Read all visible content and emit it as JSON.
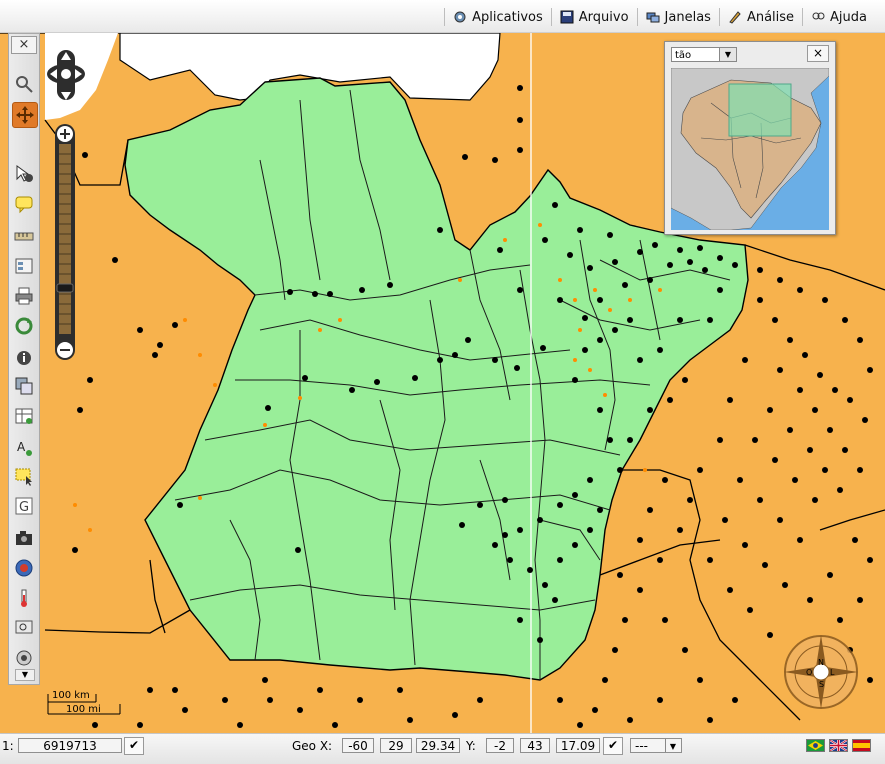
{
  "menu": {
    "items": [
      {
        "label": "Aplicativos",
        "icon": "apps-icon"
      },
      {
        "label": "Arquivo",
        "icon": "floppy-disk-icon"
      },
      {
        "label": "Janelas",
        "icon": "windows-icon"
      },
      {
        "label": "Análise",
        "icon": "analysis-icon"
      },
      {
        "label": "Ajuda",
        "icon": "help-icon"
      }
    ]
  },
  "toolbar": {
    "close_label": "×",
    "tools": [
      "zoom-box-icon",
      "pan-icon",
      "identify-icon",
      "tooltip-icon",
      "measure-icon",
      "legend-icon",
      "print-icon",
      "refresh-icon",
      "info-icon",
      "layers-icon",
      "table-icon",
      "add-text-icon",
      "select-area-icon",
      "google-icon",
      "camera-icon",
      "wikipedia-icon",
      "thermometer-icon",
      "search-icon",
      "locate-icon"
    ],
    "active_tool": "pan-icon"
  },
  "overview": {
    "selected": "tão",
    "close_label": "×"
  },
  "scale": {
    "km_label": "100 km",
    "mi_label": "100 mi"
  },
  "compass": {
    "labels": [
      "N",
      "L",
      "S",
      "O"
    ]
  },
  "status": {
    "scale_prefix": "1:",
    "scale_value": "6919713",
    "geo_x_label": "Geo X:",
    "geo_x_deg": "-60",
    "geo_x_min": "29",
    "geo_x_sec": "29.34",
    "geo_y_label": "Y:",
    "geo_y_deg": "-2",
    "geo_y_min": "43",
    "geo_y_sec": "17.09",
    "projection_value": "---",
    "confirm_label": "✔"
  },
  "colors": {
    "region_highlight": "#99ee99",
    "region_other": "#f7b24d",
    "outside": "#ffffff",
    "point_black": "#000000",
    "point_orange": "#ff8c00",
    "tool_active": "#e07a28"
  }
}
